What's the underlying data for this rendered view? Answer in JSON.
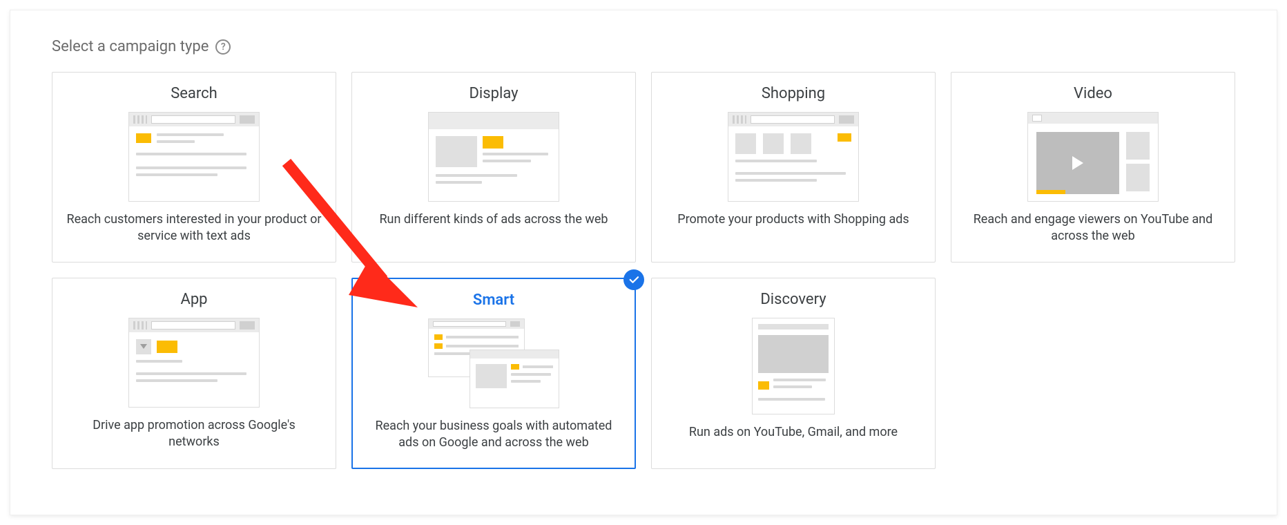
{
  "heading": "Select a campaign type",
  "helpTooltip": "?",
  "cards": {
    "search": {
      "title": "Search",
      "desc": "Reach customers interested in your product or service with text ads"
    },
    "display": {
      "title": "Display",
      "desc": "Run different kinds of ads across the web"
    },
    "shopping": {
      "title": "Shopping",
      "desc": "Promote your products with Shopping ads"
    },
    "video": {
      "title": "Video",
      "desc": "Reach and engage viewers on YouTube and across the web"
    },
    "app": {
      "title": "App",
      "desc": "Drive app promotion across Google's networks"
    },
    "smart": {
      "title": "Smart",
      "desc": "Reach your business goals with automated ads on Google and across the web"
    },
    "discovery": {
      "title": "Discovery",
      "desc": "Run ads on YouTube, Gmail, and more"
    }
  },
  "selected": "smart",
  "annotation": {
    "arrowTarget": "smart"
  },
  "colors": {
    "accent": "#1a73e8",
    "brandYellow": "#fbbc04"
  }
}
